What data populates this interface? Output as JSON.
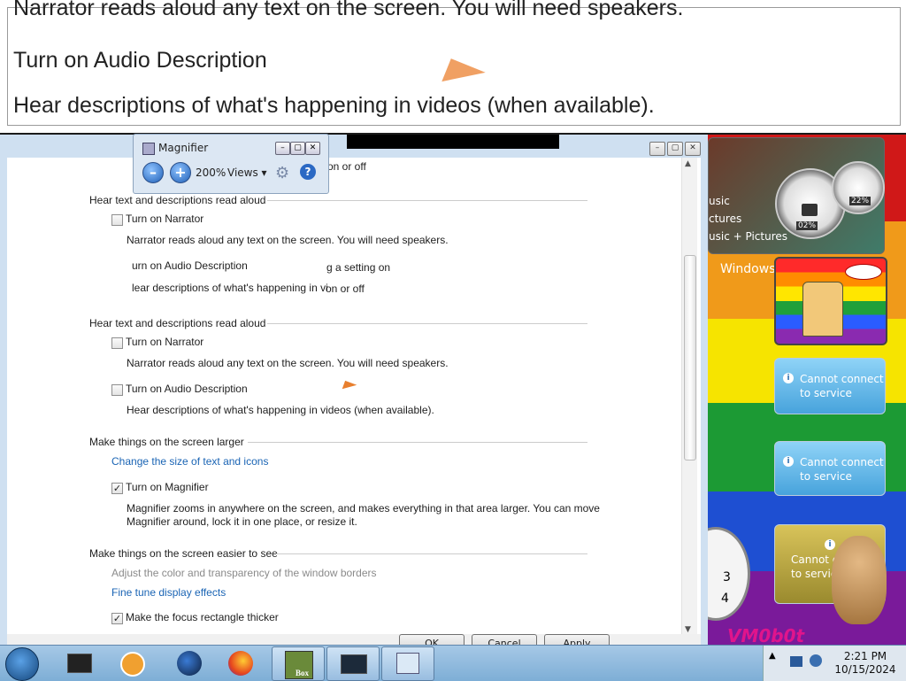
{
  "lens": {
    "line1": "Narrator reads aloud any text on the screen. You will need speakers.",
    "line2": "Turn on Audio Description",
    "line3": "Hear descriptions of what's happening in videos (when available)."
  },
  "magnifier": {
    "title": "Magnifier",
    "zoom": "200%",
    "views_label": "Views ▾",
    "minus": "–",
    "plus": "+",
    "help": "?"
  },
  "window": {
    "overlap_text_top": "on or off",
    "section1": {
      "header": "Hear text and descriptions read aloud",
      "narrator_label": "Turn on Narrator",
      "narrator_desc": "Narrator reads aloud any text on the screen. You will need speakers.",
      "audio_label": "urn on Audio Description",
      "audio_desc": "lear descriptions of what's happening in vi",
      "ghost1": "g a setting on",
      "ghost2": "on or off"
    },
    "section2": {
      "header": "Hear text and descriptions read aloud",
      "narrator_label": "Turn on Narrator",
      "narrator_desc": "Narrator reads aloud any text on the screen. You will need speakers.",
      "audio_label": "Turn on Audio Description",
      "audio_desc": "Hear descriptions of what's happening in videos (when available)."
    },
    "section3": {
      "header": "Make things on the screen larger",
      "link": "Change the size of text and icons",
      "magnifier_label": "Turn on Magnifier",
      "magnifier_checked": true,
      "magnifier_desc1": "Magnifier zooms in anywhere on the screen, and makes everything in that area larger. You can move",
      "magnifier_desc2": "Magnifier around, lock it in one place, or resize it."
    },
    "section4": {
      "header": "Make things on the screen easier to see",
      "dim_link": "Adjust the color and transparency of the window borders",
      "link": "Fine tune display effects",
      "cut_label": "Make the focus rectangle thicker"
    },
    "buttons": {
      "ok": "OK",
      "cancel": "Cancel",
      "apply": "Apply"
    }
  },
  "gadgets": {
    "media_lines": [
      "usic",
      "ctures",
      "usic + Pictures"
    ],
    "cpu_pct": "02%",
    "mem_pct": "22%",
    "windows_label": "Windows",
    "svc1": [
      "Cannot connect",
      "to service"
    ],
    "svc2": [
      "Cannot connect",
      "to service"
    ],
    "svc3": [
      "Cannot c",
      "to service"
    ],
    "clock_num": "3",
    "clock_num2": "4",
    "bottom_logo": "VM0b0t"
  },
  "taskbar": {
    "time": "2:21 PM",
    "date": "10/15/2024",
    "box_label": "Box"
  }
}
